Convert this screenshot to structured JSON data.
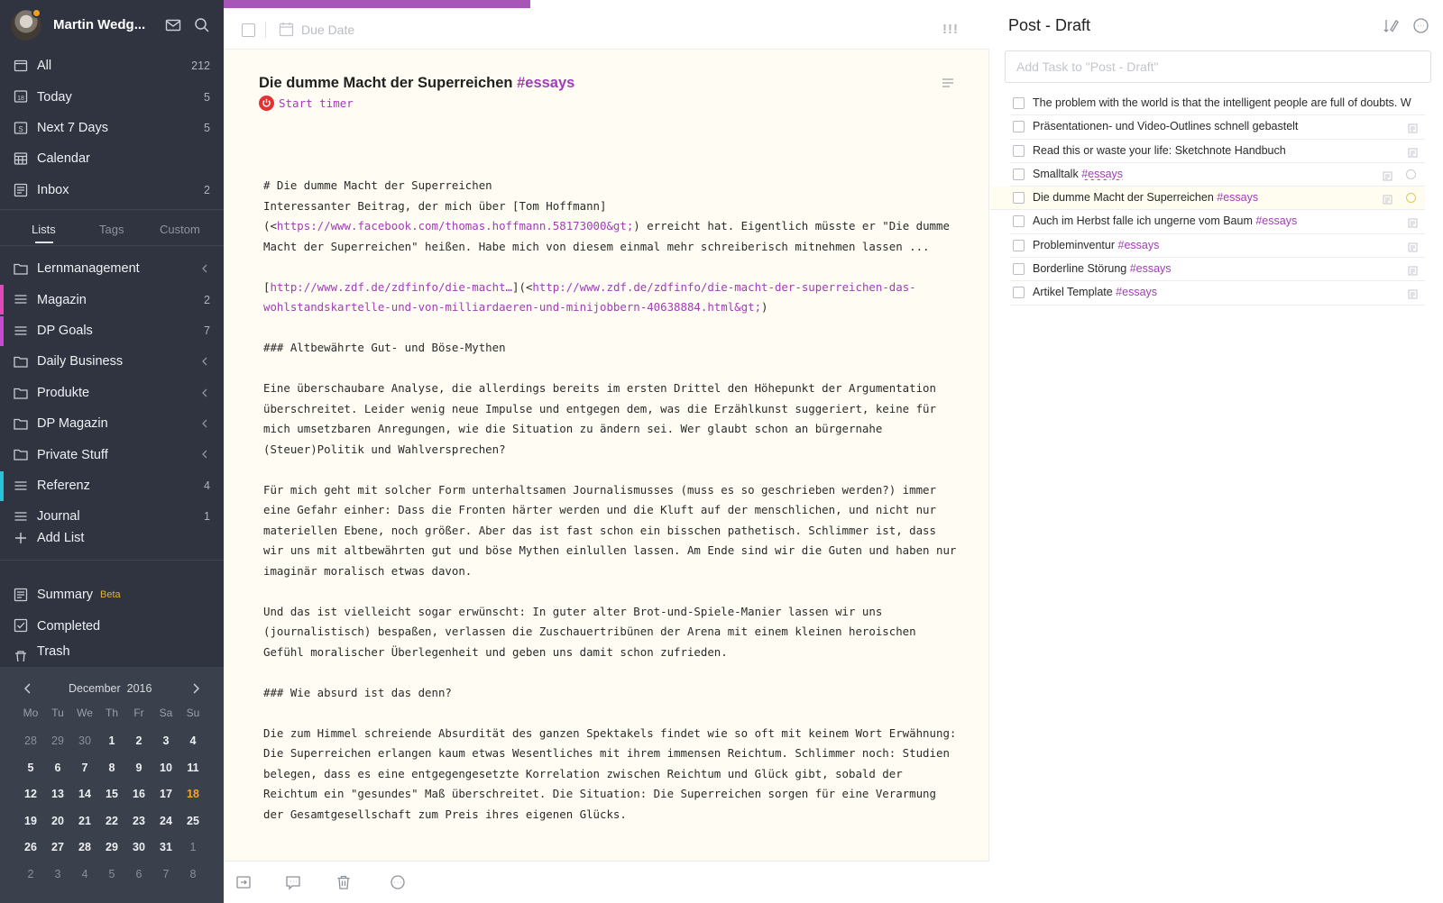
{
  "user": {
    "name": "Martin Wedg..."
  },
  "nav_smart": [
    {
      "label": "All",
      "count": "212",
      "icon": "tray-icon"
    },
    {
      "label": "Today",
      "count": "5",
      "icon": "calendar-18-icon"
    },
    {
      "label": "Next 7 Days",
      "count": "5",
      "icon": "calendar-s-icon"
    },
    {
      "label": "Calendar",
      "count": "",
      "icon": "calendar-grid-icon"
    },
    {
      "label": "Inbox",
      "count": "2",
      "icon": "inbox-icon"
    }
  ],
  "sidebar_tabs": {
    "lists": "Lists",
    "tags": "Tags",
    "custom": "Custom"
  },
  "lists": [
    {
      "label": "Lernmanagement",
      "count": "",
      "type": "folder",
      "color": ""
    },
    {
      "label": "Magazin",
      "count": "2",
      "type": "list",
      "color": "#e04ab8"
    },
    {
      "label": "DP Goals",
      "count": "7",
      "type": "list",
      "color": "#c94ad0"
    },
    {
      "label": "Daily Business",
      "count": "",
      "type": "folder",
      "color": ""
    },
    {
      "label": "Produkte",
      "count": "",
      "type": "folder",
      "color": ""
    },
    {
      "label": "DP Magazin",
      "count": "",
      "type": "folder",
      "color": ""
    },
    {
      "label": "Private Stuff",
      "count": "",
      "type": "folder",
      "color": ""
    },
    {
      "label": "Referenz",
      "count": "4",
      "type": "list",
      "color": "#27c3d8"
    },
    {
      "label": "Journal",
      "count": "1",
      "type": "list",
      "color": ""
    }
  ],
  "add_list": "Add List",
  "summary": {
    "label": "Summary",
    "badge": "Beta"
  },
  "completed": "Completed",
  "trash": "Trash",
  "calendar": {
    "month": "December",
    "year": "2016",
    "dow": [
      "Mo",
      "Tu",
      "We",
      "Th",
      "Fr",
      "Sa",
      "Su"
    ],
    "days": [
      [
        "28",
        "muted"
      ],
      [
        "29",
        "muted"
      ],
      [
        "30",
        "muted"
      ],
      [
        "1",
        ""
      ],
      [
        "2",
        ""
      ],
      [
        "3",
        ""
      ],
      [
        "4",
        ""
      ],
      [
        "5",
        ""
      ],
      [
        "6",
        ""
      ],
      [
        "7",
        ""
      ],
      [
        "8",
        ""
      ],
      [
        "9",
        ""
      ],
      [
        "10",
        ""
      ],
      [
        "11",
        ""
      ],
      [
        "12",
        ""
      ],
      [
        "13",
        ""
      ],
      [
        "14",
        ""
      ],
      [
        "15",
        ""
      ],
      [
        "16",
        ""
      ],
      [
        "17",
        ""
      ],
      [
        "18",
        "today"
      ],
      [
        "19",
        ""
      ],
      [
        "20",
        ""
      ],
      [
        "21",
        ""
      ],
      [
        "22",
        ""
      ],
      [
        "23",
        ""
      ],
      [
        "24",
        ""
      ],
      [
        "25",
        ""
      ],
      [
        "26",
        ""
      ],
      [
        "27",
        ""
      ],
      [
        "28",
        ""
      ],
      [
        "29",
        ""
      ],
      [
        "30",
        ""
      ],
      [
        "31",
        ""
      ],
      [
        "1",
        "muted"
      ],
      [
        "2",
        "muted"
      ],
      [
        "3",
        "muted"
      ],
      [
        "4",
        "muted"
      ],
      [
        "5",
        "muted"
      ],
      [
        "6",
        "muted"
      ],
      [
        "7",
        "muted"
      ],
      [
        "8",
        "muted"
      ]
    ]
  },
  "toolbar": {
    "due_date": "Due Date",
    "priority": "!!!"
  },
  "task": {
    "title": "Die dumme Macht der Superreichen",
    "title_tag": "#essays",
    "timer_label": "Start timer"
  },
  "note": [
    [
      "# Die dumme Macht der Superreichen"
    ],
    [
      "Interessanter Beitrag, der mich über [Tom Hoffmann]"
    ],
    [
      "(<",
      "https://www.facebook.com/thomas.hoffmann.58173000&gt;",
      ") erreicht hat. Eigentlich müsste er \"Die dumme Macht der Superreichen\" heißen. Habe mich von diesem einmal mehr schreiberisch mitnehmen lassen ..."
    ],
    [
      ""
    ],
    [
      "[",
      "http://www.zdf.de/zdfinfo/die-macht…",
      "](<",
      "http://www.zdf.de/zdfinfo/die-macht-der-superreichen-das-wohlstandskartelle-und-von-milliardaeren-und-minijobbern-40638884.html&gt;",
      ")"
    ],
    [
      ""
    ],
    [
      "### Altbewährte Gut- und Böse-Mythen"
    ],
    [
      ""
    ],
    [
      "Eine überschaubare Analyse, die allerdings bereits im ersten Drittel den Höhepunkt der Argumentation überschreitet. Leider wenig neue Impulse und entgegen dem, was die Erzählkunst suggeriert, keine für mich umsetzbaren Anregungen, wie die Situation zu ändern sei. Wer glaubt schon an bürgernahe (Steuer)Politik und Wahlversprechen?"
    ],
    [
      ""
    ],
    [
      "Für mich geht mit solcher Form unterhaltsamen Journalismusses (muss es so geschrieben werden?) immer eine Gefahr einher: Dass die Fronten härter werden und die Kluft auf der menschlichen, und nicht nur materiellen Ebene, noch größer. Aber das ist fast schon ein bisschen pathetisch. Schlimmer ist, dass wir uns mit altbewährten gut und böse Mythen einlullen lassen. Am Ende sind wir die Guten und haben nur imaginär moralisch etwas davon."
    ],
    [
      ""
    ],
    [
      "Und das ist vielleicht sogar erwünscht: In guter alter Brot-und-Spiele-Manier lassen wir uns (journalistisch) bespaßen, verlassen die Zuschauertribünen der Arena mit einem kleinen heroischen Gefühl moralischer Überlegenheit und geben uns damit schon zufrieden."
    ],
    [
      ""
    ],
    [
      "### Wie absurd ist das denn?"
    ],
    [
      ""
    ],
    [
      "Die zum Himmel schreiende Absurdität des ganzen Spektakels findet wie so oft mit keinem Wort Erwähnung: Die Superreichen erlangen kaum etwas Wesentliches mit ihrem immensen Reichtum. Schlimmer noch: Studien belegen, dass es eine entgegengesetzte Korrelation zwischen Reichtum und Glück gibt, sobald der Reichtum ein \"gesundes\" Maß überschreitet. Die Situation: Die Superreichen sorgen für eine Verarmung der Gesamtgesellschaft zum Preis ihres eigenen Glücks."
    ]
  ],
  "right": {
    "title": "Post - Draft",
    "add_placeholder": "Add Task to \"Post - Draft\"",
    "tasks": [
      {
        "text": "The problem with the world is that the intelligent people are full of doubts. W",
        "tag": "",
        "note": false,
        "clock": false,
        "selected": false,
        "squig": false
      },
      {
        "text": "Präsentationen- und Video-Outlines schnell gebastelt",
        "tag": "",
        "note": true,
        "clock": false,
        "selected": false,
        "squig": false
      },
      {
        "text": "Read this or waste your life: Sketchnote Handbuch",
        "tag": "",
        "note": true,
        "clock": false,
        "selected": false,
        "squig": false
      },
      {
        "text": "Smalltalk ",
        "tag": "#essays",
        "note": true,
        "clock": true,
        "selected": false,
        "squig": true
      },
      {
        "text": "Die dumme Macht der Superreichen ",
        "tag": "#essays",
        "note": true,
        "clock": true,
        "selected": true,
        "squig": false
      },
      {
        "text": "Auch im Herbst falle ich ungerne vom Baum ",
        "tag": "#essays",
        "note": true,
        "clock": false,
        "selected": false,
        "squig": false
      },
      {
        "text": "Probleminventur ",
        "tag": "#essays",
        "note": true,
        "clock": false,
        "selected": false,
        "squig": false
      },
      {
        "text": "Borderline Störung ",
        "tag": "#essays",
        "note": true,
        "clock": false,
        "selected": false,
        "squig": false
      },
      {
        "text": "Artikel Template ",
        "tag": "#essays",
        "note": true,
        "clock": false,
        "selected": false,
        "squig": false
      }
    ]
  },
  "colors": {
    "accent": "#a03db5",
    "sidebar_bg": "#2f3440",
    "today": "#f5a623",
    "timer": "#e23232",
    "editor_bg": "#fffdf3"
  }
}
